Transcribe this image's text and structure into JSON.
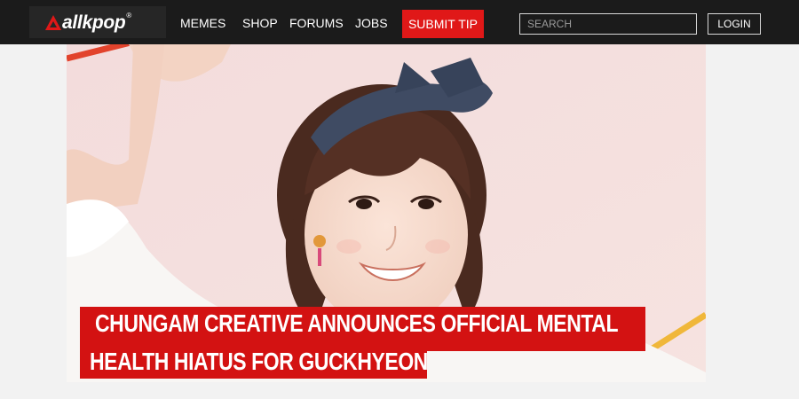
{
  "site": {
    "logo": {
      "word": "allkpop",
      "reg": "®",
      "icon": "allkpop-a-mark-icon",
      "color": "#e01818"
    }
  },
  "nav": {
    "items": [
      "MEMES",
      "SHOP",
      "FORUMS",
      "JOBS"
    ],
    "submit_tip": "SUBMIT TIP",
    "accent": "#e01818"
  },
  "search": {
    "placeholder": "SEARCH",
    "value": ""
  },
  "account": {
    "login": "LOGIN"
  },
  "hero": {
    "headline_line1": "CHUNGAM CREATIVE ANNOUNCES OFFICIAL MENTAL",
    "headline_line2": "HEALTH HIATUS FOR GUCKHYEON",
    "headline_bg": "#d31212"
  }
}
